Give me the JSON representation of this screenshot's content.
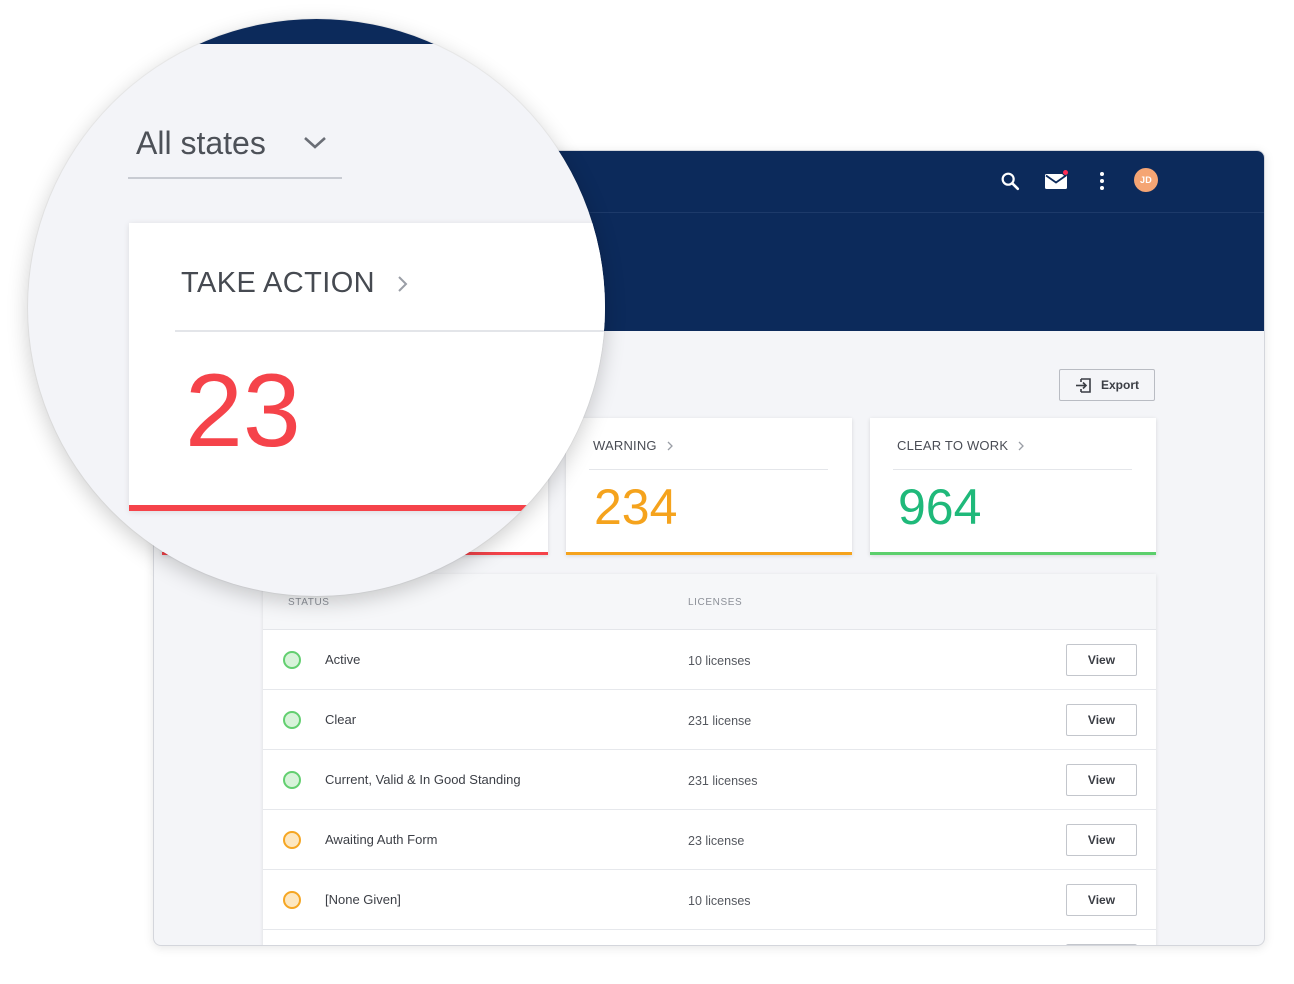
{
  "colors": {
    "navy": "#0c2a5b",
    "danger": "#f5434a",
    "warning": "#f5a31d",
    "success": "#1fb97a",
    "success_bar": "#5ccf6c",
    "dot_green_fill": "#d7f3d9",
    "dot_green_border": "#63cf70",
    "dot_orange_fill": "#fde7c0",
    "dot_orange_border": "#f5a623"
  },
  "header": {
    "icons": [
      "search-icon",
      "mail-icon",
      "more-vertical-icon"
    ],
    "avatar_initials": "JD"
  },
  "toolbar": {
    "export_label": "Export",
    "export_icon": "export-icon"
  },
  "filter": {
    "selected": "All states",
    "icon": "chevron-down-icon"
  },
  "cards": [
    {
      "title": "TAKE ACTION",
      "value": "23",
      "color": "danger"
    },
    {
      "title": "WARNING",
      "value": "234",
      "color": "warning"
    },
    {
      "title": "CLEAR TO WORK",
      "value": "964",
      "color": "success"
    }
  ],
  "table": {
    "columns": [
      "STATUS",
      "LICENSES"
    ],
    "action_label": "View",
    "rows": [
      {
        "status": "Active",
        "licenses": "10 licenses",
        "state": "green"
      },
      {
        "status": "Clear",
        "licenses": "231 license",
        "state": "green"
      },
      {
        "status": "Current, Valid & In Good Standing",
        "licenses": "231 licenses",
        "state": "green"
      },
      {
        "status": "Awaiting Auth Form",
        "licenses": "23 license",
        "state": "orange"
      },
      {
        "status": "[None Given]",
        "licenses": "10 licenses",
        "state": "orange"
      }
    ]
  }
}
